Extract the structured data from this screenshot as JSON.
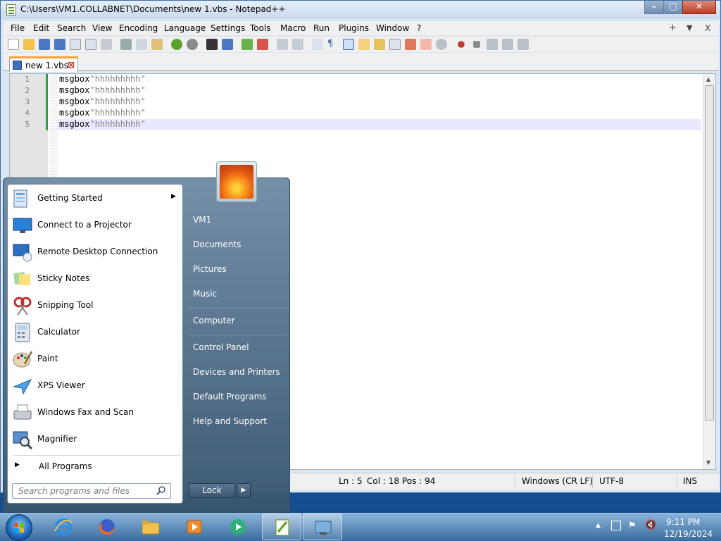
{
  "window": {
    "title": "C:\\Users\\VM1.COLLABNET\\Documents\\new 1.vbs - Notepad++",
    "menu": [
      "File",
      "Edit",
      "Search",
      "View",
      "Encoding",
      "Language",
      "Settings",
      "Tools",
      "Macro",
      "Run",
      "Plugins",
      "Window",
      "?"
    ],
    "menu_right": [
      "+",
      "▼",
      "X"
    ],
    "tab_label": "new 1.vbs"
  },
  "editor": {
    "lines": [
      {
        "num": "1",
        "kw": "msgbox",
        "str": "\"hhhhhhhhh\""
      },
      {
        "num": "2",
        "kw": "msgbox",
        "str": "\"hhhhhhhhh\""
      },
      {
        "num": "3",
        "kw": "msgbox",
        "str": "\"hhhhhhhhh\""
      },
      {
        "num": "4",
        "kw": "msgbox",
        "str": "\"hhhhhhhhh\""
      },
      {
        "num": "5",
        "kw": "msgbox",
        "str": "\"hhhhhhhhh\""
      }
    ]
  },
  "status": {
    "ln": "Ln : 5",
    "col": "Col : 18",
    "pos": "Pos : 94",
    "eol": "Windows (CR LF)",
    "encoding": "UTF-8",
    "mode": "INS"
  },
  "start_menu": {
    "programs": [
      {
        "label": "Getting Started",
        "icon": "getting-started-icon",
        "submenu": true
      },
      {
        "label": "Connect to a Projector",
        "icon": "projector-icon"
      },
      {
        "label": "Remote Desktop Connection",
        "icon": "remote-desktop-icon"
      },
      {
        "label": "Sticky Notes",
        "icon": "sticky-notes-icon"
      },
      {
        "label": "Snipping Tool",
        "icon": "snipping-tool-icon"
      },
      {
        "label": "Calculator",
        "icon": "calculator-icon"
      },
      {
        "label": "Paint",
        "icon": "paint-icon"
      },
      {
        "label": "XPS Viewer",
        "icon": "xps-viewer-icon"
      },
      {
        "label": "Windows Fax and Scan",
        "icon": "fax-scan-icon"
      },
      {
        "label": "Magnifier",
        "icon": "magnifier-icon"
      }
    ],
    "all_programs": "All Programs",
    "search_placeholder": "Search programs and files",
    "right": [
      "VM1",
      "Documents",
      "Pictures",
      "Music",
      "Computer",
      "Control Panel",
      "Devices and Printers",
      "Default Programs",
      "Help and Support"
    ],
    "lock": "Lock"
  },
  "taskbar": {
    "time": "9:11 PM",
    "date": "12/19/2024",
    "items": [
      "internet-explorer-icon",
      "firefox-icon",
      "explorer-icon",
      "media-player-icon",
      "media-center-icon",
      "notepadpp-icon",
      "screen-icon"
    ]
  },
  "colors": {
    "accent": "#f7a33b",
    "changed_line": "#2ea043",
    "current_line": "#e8e8ff"
  }
}
